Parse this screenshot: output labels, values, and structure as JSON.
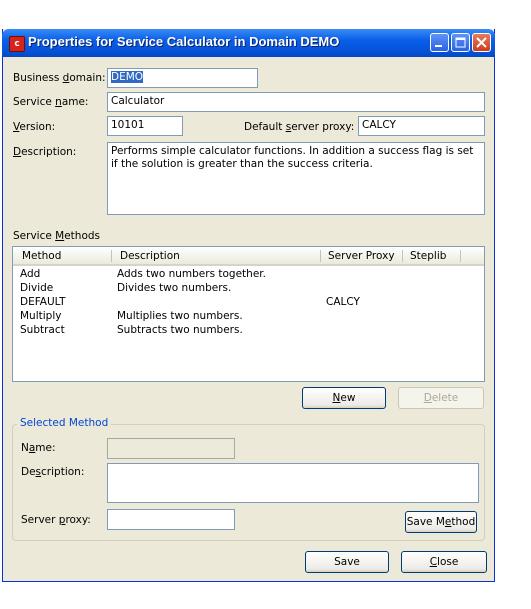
{
  "window": {
    "title": "Properties for Service Calculator in Domain DEMO",
    "title_color": "#0553d9"
  },
  "form": {
    "business_domain_label_pre": "Business ",
    "business_domain_label_u": "d",
    "business_domain_label_post": "omain:",
    "business_domain_value": "DEMO",
    "service_name_label_pre": "Service ",
    "service_name_label_u": "n",
    "service_name_label_post": "ame:",
    "service_name_value": "Calculator",
    "version_label_u": "V",
    "version_label_post": "ersion:",
    "version_value": "10101",
    "proxy_label_pre": "Default ",
    "proxy_label_u": "s",
    "proxy_label_post": "erver proxy:",
    "proxy_value": "CALCY",
    "description_label_u": "D",
    "description_label_post": "escription:",
    "description_value": "Performs simple calculator functions. In addition a success flag is set if the solution is greater than the success criteria."
  },
  "methods": {
    "label_pre": "Service ",
    "label_u": "M",
    "label_post": "ethods",
    "columns": [
      "Method",
      "Description",
      "Server Proxy",
      "Steplib"
    ],
    "rows": [
      {
        "method": "Add",
        "description": "Adds two numbers together.",
        "proxy": "",
        "steplib": ""
      },
      {
        "method": "Divide",
        "description": "Divides two numbers.",
        "proxy": "",
        "steplib": ""
      },
      {
        "method": "DEFAULT",
        "description": "",
        "proxy": "CALCY",
        "steplib": ""
      },
      {
        "method": "Multiply",
        "description": "Multiplies two numbers.",
        "proxy": "",
        "steplib": ""
      },
      {
        "method": "Subtract",
        "description": "Subtracts two numbers.",
        "proxy": "",
        "steplib": ""
      }
    ],
    "new_u": "N",
    "new_post": "ew",
    "delete_u": "D",
    "delete_post": "elete"
  },
  "selected": {
    "title": "Selected Method",
    "name_label_pre": "N",
    "name_label_u": "a",
    "name_label_post": "me:",
    "name_value": "",
    "description_label_pre": "De",
    "description_label_u": "s",
    "description_label_post": "cription:",
    "description_value": "",
    "proxy_label_pre": "Server ",
    "proxy_label_u": "p",
    "proxy_label_post": "roxy:",
    "proxy_value": "",
    "save_method_pre": "Save M",
    "save_method_u": "e",
    "save_method_post": "thod"
  },
  "footer": {
    "save": "Save",
    "close_u": "C",
    "close_post": "lose"
  }
}
